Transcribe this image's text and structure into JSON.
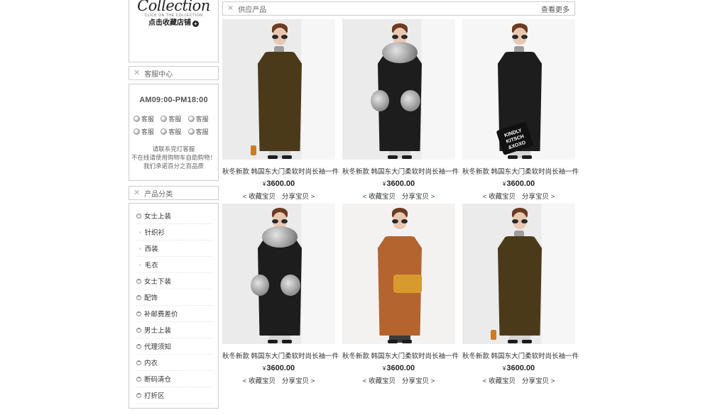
{
  "sidebar": {
    "collection_script": "Collection",
    "collection_sub": "CLICK ON THE COLLECTION",
    "collect_link": "点击收藏店铺",
    "service_header": "客服中心",
    "hours": "AM09:00-PM18:00",
    "qq_label": "客服",
    "service_note_lines": [
      "请联系完灯客服",
      "不在线请使用购物车自助购物！",
      "我们承诺百分之百品质"
    ],
    "category_header": "产品分类",
    "categories": [
      {
        "label": "女士上装",
        "type": "open"
      },
      {
        "label": "针织衫",
        "type": "sub"
      },
      {
        "label": "西装",
        "type": "sub"
      },
      {
        "label": "毛衣",
        "type": "sub"
      },
      {
        "label": "女士下装",
        "type": "closed"
      },
      {
        "label": "配饰",
        "type": "closed"
      },
      {
        "label": "补邮费差价",
        "type": "closed"
      },
      {
        "label": "男士上装",
        "type": "closed"
      },
      {
        "label": "代理须知",
        "type": "closed"
      },
      {
        "label": "内衣",
        "type": "closed"
      },
      {
        "label": "断码清仓",
        "type": "closed"
      },
      {
        "label": "打折区",
        "type": "closed"
      }
    ]
  },
  "main": {
    "header": "供应产品",
    "more": "查看更多",
    "currency": "¥",
    "collect_label": "< 收藏宝贝",
    "share_label": "分享宝贝 >",
    "products": [
      {
        "title": "秋冬新款 韩国东大门柔软时尚长袖一件",
        "price": "3600.00",
        "style": "olive"
      },
      {
        "title": "秋冬新款 韩国东大门柔软时尚长袖一件",
        "price": "3600.00",
        "style": "puffer-fur"
      },
      {
        "title": "秋冬新款 韩国东大门柔软时尚长袖一件",
        "price": "3600.00",
        "style": "puffer-bag"
      },
      {
        "title": "秋冬新款 韩国东大门柔软时尚长袖一件",
        "price": "3600.00",
        "style": "puffer-fur"
      },
      {
        "title": "秋冬新款 韩国东大门柔软时尚长袖一件",
        "price": "3600.00",
        "style": "camel"
      },
      {
        "title": "秋冬新款 韩国东大门柔软时尚长袖一件",
        "price": "3600.00",
        "style": "olive"
      }
    ],
    "bag_text": "KINDLY KITSCH &XOXO"
  },
  "colors": {
    "olive": "#4b3a1a",
    "black": "#1d1d1d",
    "camel": "#b4642f",
    "bag": "#d89a2c",
    "border": "#cccccc"
  }
}
